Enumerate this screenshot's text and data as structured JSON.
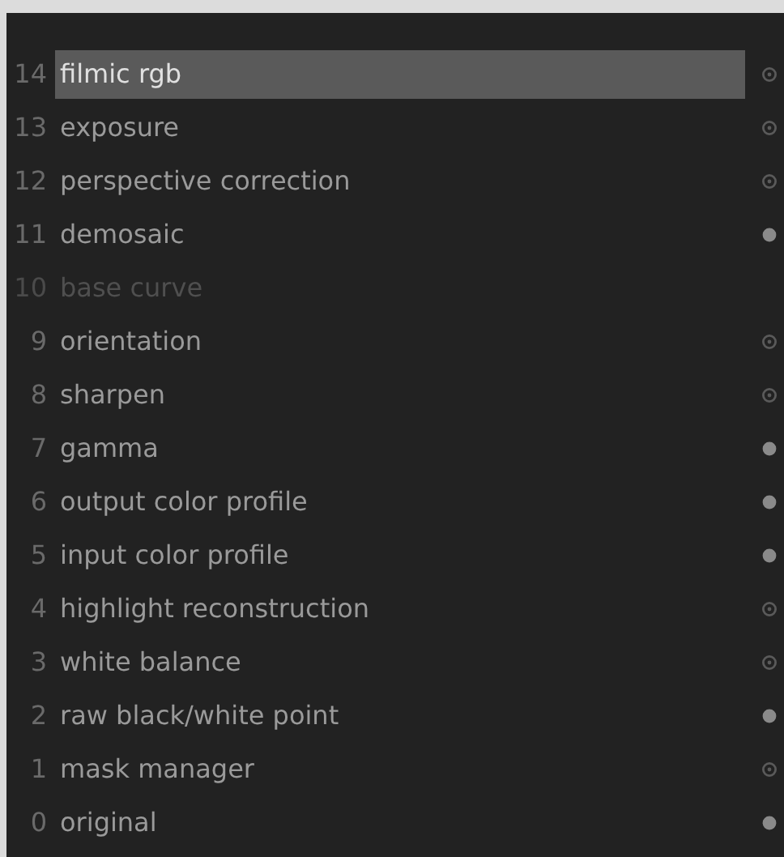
{
  "history": [
    {
      "number": "14",
      "name": "filmic rgb",
      "selected": true,
      "disabled": false,
      "kind": "ring"
    },
    {
      "number": "13",
      "name": "exposure",
      "selected": false,
      "disabled": false,
      "kind": "ring"
    },
    {
      "number": "12",
      "name": "perspective correction",
      "selected": false,
      "disabled": false,
      "kind": "ring"
    },
    {
      "number": "11",
      "name": "demosaic",
      "selected": false,
      "disabled": false,
      "kind": "dot"
    },
    {
      "number": "10",
      "name": "base curve",
      "selected": false,
      "disabled": true,
      "kind": "none"
    },
    {
      "number": "9",
      "name": "orientation",
      "selected": false,
      "disabled": false,
      "kind": "ring"
    },
    {
      "number": "8",
      "name": "sharpen",
      "selected": false,
      "disabled": false,
      "kind": "ring"
    },
    {
      "number": "7",
      "name": "gamma",
      "selected": false,
      "disabled": false,
      "kind": "dot"
    },
    {
      "number": "6",
      "name": "output color profile",
      "selected": false,
      "disabled": false,
      "kind": "dot"
    },
    {
      "number": "5",
      "name": "input color profile",
      "selected": false,
      "disabled": false,
      "kind": "dot"
    },
    {
      "number": "4",
      "name": "highlight reconstruction",
      "selected": false,
      "disabled": false,
      "kind": "ring"
    },
    {
      "number": "3",
      "name": "white balance",
      "selected": false,
      "disabled": false,
      "kind": "ring"
    },
    {
      "number": "2",
      "name": "raw black/white point",
      "selected": false,
      "disabled": false,
      "kind": "dot"
    },
    {
      "number": "1",
      "name": "mask manager",
      "selected": false,
      "disabled": false,
      "kind": "ring"
    },
    {
      "number": "0",
      "name": "original",
      "selected": false,
      "disabled": false,
      "kind": "dot"
    }
  ]
}
